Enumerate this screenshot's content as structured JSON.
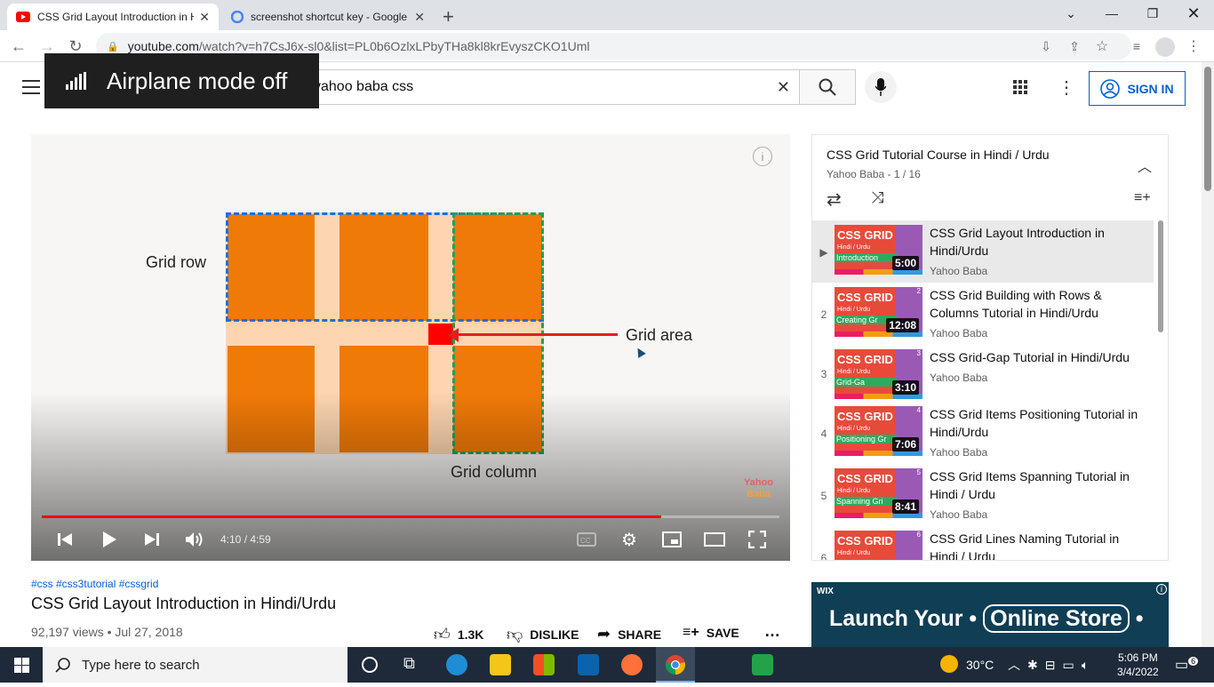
{
  "browser": {
    "tabs": [
      {
        "title": "CSS Grid Layout Introduction in H"
      },
      {
        "title": "screenshot shortcut key - Google"
      }
    ],
    "url_host": "youtube.com",
    "url_path": "/watch?v=h7CsJ6x-sl0&list=PL0b6OzlxLPbyTHa8kl8krEvyszCKO1Uml"
  },
  "toast": {
    "text": "Airplane mode off"
  },
  "youtube": {
    "search_value": "yahoo baba css",
    "signin_label": "SIGN IN"
  },
  "video": {
    "labels": {
      "row": "Grid row",
      "area": "Grid area",
      "column": "Grid column",
      "watermark_top": "Yahoo",
      "watermark_bottom": "Baba"
    },
    "time": "4:10 / 4:59",
    "progress": 0.84,
    "tags": "#css #css3tutorial #cssgrid",
    "title": "CSS Grid Layout Introduction in Hindi/Urdu",
    "meta": "92,197 views • Jul 27, 2018",
    "likes": "1.3K",
    "dislike_label": "DISLIKE",
    "share_label": "SHARE",
    "save_label": "SAVE"
  },
  "playlist": {
    "title": "CSS Grid Tutorial Course in Hindi / Urdu",
    "subtitle": "Yahoo Baba - 1 / 16",
    "items": [
      {
        "index": "▶",
        "num": "",
        "thumb_title": "CSS GRID",
        "thumb_sub": "Hindi / Urdu",
        "thumb_tag": "Introduction",
        "duration": "5:00",
        "title": "CSS Grid Layout Introduction in Hindi/Urdu",
        "channel": "Yahoo Baba"
      },
      {
        "index": "2",
        "num": "2",
        "thumb_title": "CSS GRID",
        "thumb_sub": "Hindi / Urdu",
        "thumb_tag": "Creating Gr",
        "duration": "12:08",
        "title": "CSS Grid Building with Rows & Columns Tutorial in Hindi/Urdu",
        "channel": "Yahoo Baba"
      },
      {
        "index": "3",
        "num": "3",
        "thumb_title": "CSS GRID",
        "thumb_sub": "Hindi / Urdu",
        "thumb_tag": "Grid-Ga",
        "duration": "3:10",
        "title": "CSS Grid-Gap Tutorial in Hindi/Urdu",
        "channel": "Yahoo Baba"
      },
      {
        "index": "4",
        "num": "4",
        "thumb_title": "CSS GRID",
        "thumb_sub": "Hindi / Urdu",
        "thumb_tag": "Positioning Gr",
        "duration": "7:06",
        "title": "CSS Grid Items Positioning Tutorial in Hindi/Urdu",
        "channel": "Yahoo Baba"
      },
      {
        "index": "5",
        "num": "5",
        "thumb_title": "CSS GRID",
        "thumb_sub": "Hindi / Urdu",
        "thumb_tag": "Spanning Gri",
        "duration": "8:41",
        "title": "CSS Grid Items Spanning Tutorial in Hindi / Urdu",
        "channel": "Yahoo Baba"
      },
      {
        "index": "6",
        "num": "6",
        "thumb_title": "CSS GRID",
        "thumb_sub": "Hindi / Urdu",
        "thumb_tag": "",
        "duration": "",
        "title": "CSS Grid Lines Naming Tutorial in Hindi / Urdu",
        "channel": ""
      }
    ]
  },
  "ad": {
    "brand": "WIX",
    "headline_a": "Launch Your",
    "headline_b": "Online Store"
  },
  "taskbar": {
    "search_placeholder": "Type here to search",
    "weather": "30°C",
    "time": "5:06 PM",
    "date": "3/4/2022",
    "notifications": "6"
  },
  "colors": {
    "accent": "#065fd4",
    "progress": "#ff0000",
    "grid_cell": "#f07a08",
    "grid_bg": "#fdd5b0"
  }
}
